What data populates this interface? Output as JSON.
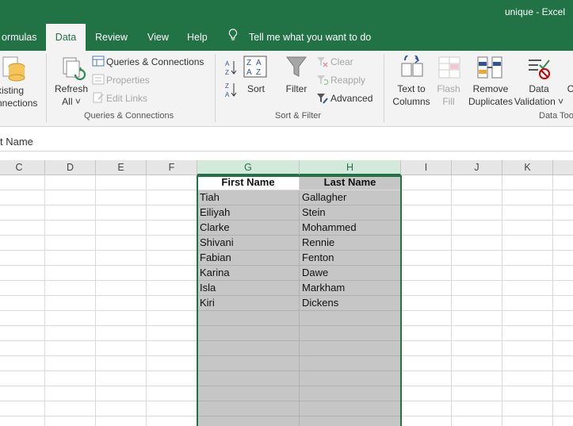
{
  "window": {
    "title": "unique  -  Excel"
  },
  "tabs": [
    "ormulas",
    "Data",
    "Review",
    "View",
    "Help"
  ],
  "tell_me": "Tell me what you want to do",
  "ribbon": {
    "existing_connections": [
      "xisting",
      "nnections"
    ],
    "refresh_all": [
      "Refresh",
      "All ˅"
    ],
    "queries_connections": "Queries & Connections",
    "properties": "Properties",
    "edit_links": "Edit Links",
    "group_queries": "Queries & Connections",
    "sort_az": "A↓Z",
    "sort_za": "Z↓A",
    "sort": "Sort",
    "filter": "Filter",
    "clear": "Clear",
    "reapply": "Reapply",
    "advanced": "Advanced",
    "group_sort_filter": "Sort & Filter",
    "text_to_columns": [
      "Text to",
      "Columns"
    ],
    "flash_fill": [
      "Flash",
      "Fill"
    ],
    "remove_duplicates": [
      "Remove",
      "Duplicates"
    ],
    "data_validation": [
      "Data",
      "Validation ˅"
    ],
    "consolidate": "C",
    "group_data_tools": "Data Too"
  },
  "formula_bar": {
    "content": "t Name"
  },
  "columns": [
    "C",
    "D",
    "E",
    "F",
    "G",
    "H",
    "I",
    "J",
    "K"
  ],
  "table": {
    "headers": [
      "First Name",
      "Last Name"
    ],
    "rows": [
      [
        "Tiah",
        "Gallagher"
      ],
      [
        "Eiliyah",
        "Stein"
      ],
      [
        "Clarke",
        "Mohammed"
      ],
      [
        "Shivani",
        "Rennie"
      ],
      [
        "Fabian",
        "Fenton"
      ],
      [
        "Karina",
        "Dawe"
      ],
      [
        "Isla",
        "Markham"
      ],
      [
        "Kiri",
        "Dickens"
      ]
    ]
  },
  "colors": {
    "accent": "#217346",
    "selection_fill": "#c6c6c6"
  }
}
